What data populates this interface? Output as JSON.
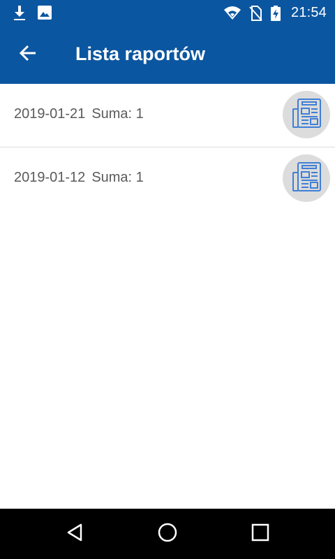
{
  "status_bar": {
    "time": "21:54",
    "left_icons": [
      "download-icon",
      "image-icon"
    ],
    "right_icons": [
      "wifi-icon",
      "no-sim-icon",
      "battery-charging-icon"
    ]
  },
  "app_bar": {
    "title": "Lista raportów",
    "back_icon": "arrow-back-icon"
  },
  "reports": [
    {
      "date": "2019-01-21",
      "sum": "Suma: 1",
      "icon": "report-document-icon"
    },
    {
      "date": "2019-01-12",
      "sum": "Suma: 1",
      "icon": "report-document-icon"
    }
  ],
  "nav_bar": {
    "icons": [
      "back-triangle-icon",
      "home-circle-icon",
      "recents-square-icon"
    ]
  },
  "colors": {
    "primary": "#0b56a0",
    "avatar_bg": "#dcdcdc",
    "icon_blue": "#3f7fd6",
    "text": "#5a5a5a"
  }
}
